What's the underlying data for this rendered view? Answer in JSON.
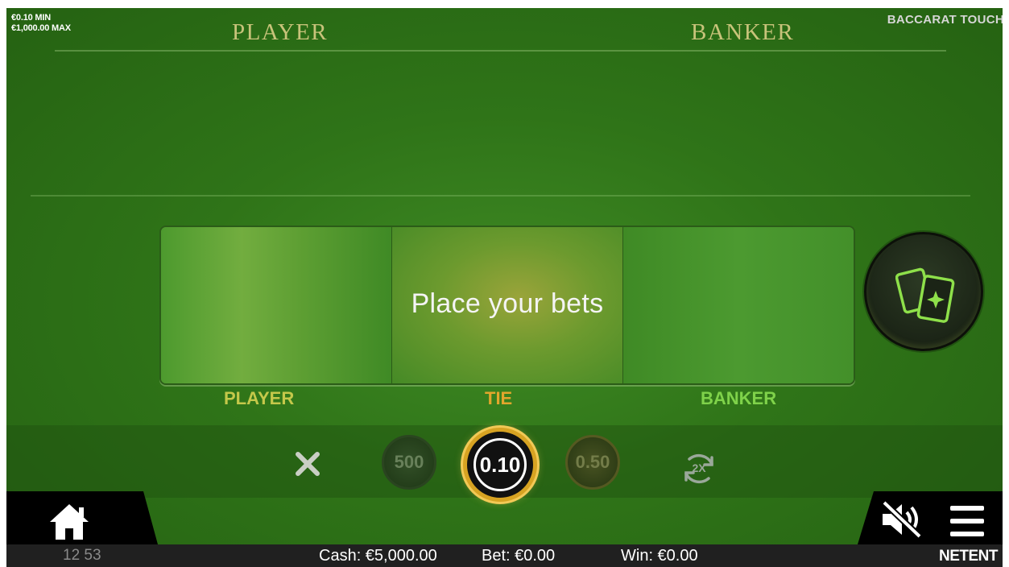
{
  "limits": {
    "min": "€0.10 MIN",
    "max": "€1,000.00 MAX"
  },
  "game_title": "BACCARAT TOUCH",
  "table_headers": {
    "player": "PLAYER",
    "banker": "BANKER"
  },
  "bet_area": {
    "message": "Place your bets"
  },
  "bet_labels": {
    "player": "PLAYER",
    "tie": "TIE",
    "banker": "BANKER"
  },
  "chips": {
    "left": "500",
    "selected": "0.10",
    "right": "0.50"
  },
  "controls": {
    "clear_icon": "close-icon",
    "rebet_icon": "rebet-2x-icon",
    "deal_icon": "cards-icon",
    "home_icon": "home-icon",
    "sound_icon": "sound-off-icon",
    "menu_icon": "hamburger-menu-icon"
  },
  "status": {
    "clock": "12 53",
    "cash": "Cash: €5,000.00",
    "bet": "Bet: €0.00",
    "win": "Win: €0.00",
    "brand": "NETENT"
  },
  "colors": {
    "felt": "#2f7418",
    "player_label": "#c4c84a",
    "tie_label": "#e2a62c",
    "banker_label": "#7fd24a",
    "chip_ring": "#d7a322"
  }
}
